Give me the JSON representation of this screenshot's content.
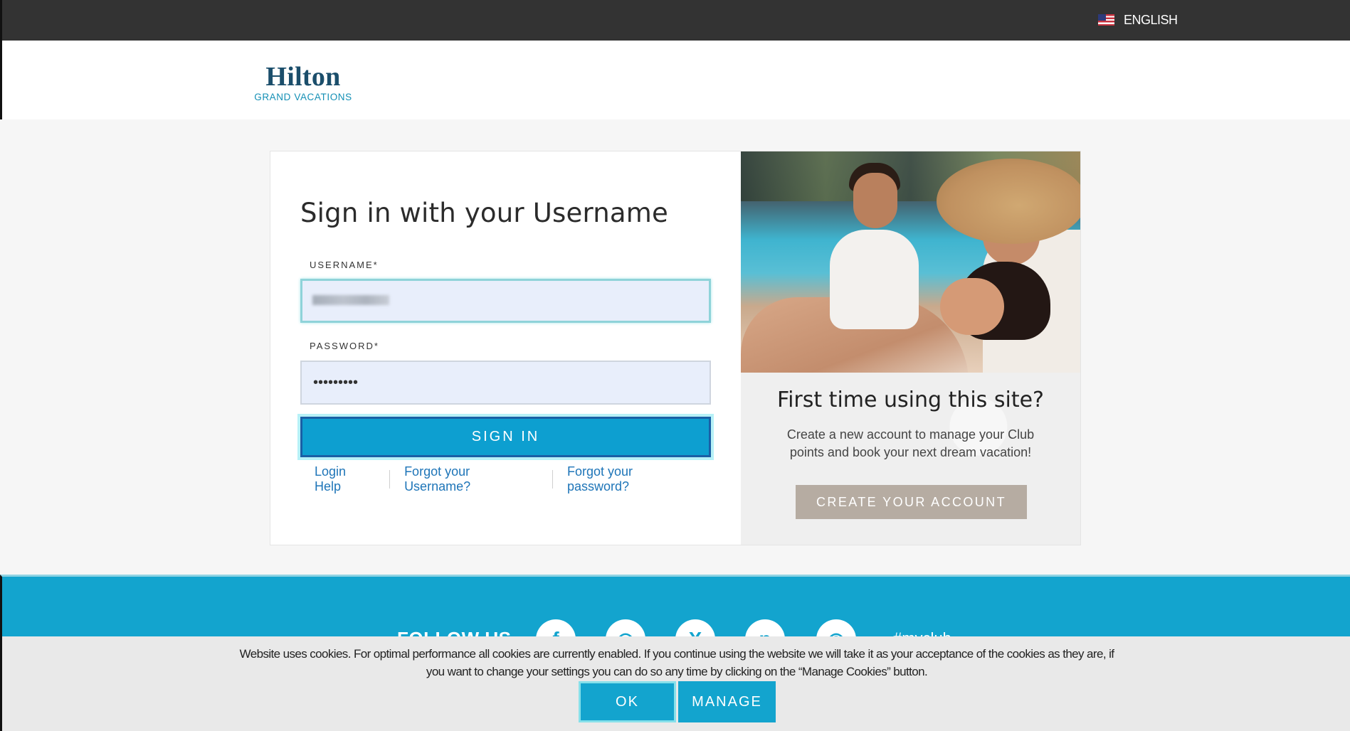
{
  "topbar": {
    "language": "ENGLISH",
    "flag_icon": "us-flag-icon"
  },
  "header": {
    "logo_main": "Hilton",
    "logo_sub": "GRAND VACATIONS"
  },
  "signin": {
    "title": "Sign in with your Username",
    "username_label": "USERNAME*",
    "username_value": "",
    "password_label": "PASSWORD*",
    "password_value": "•••••••••",
    "submit_label": "SIGN IN",
    "help_links": [
      "Login Help",
      "Forgot your Username?",
      "Forgot your password?"
    ]
  },
  "promo": {
    "title": "First time using this site?",
    "description": "Create a new account to manage your Club points and book your next dream vacation!",
    "create_label": "CREATE YOUR ACCOUNT"
  },
  "footer": {
    "follow_label": "FOLLOW US",
    "social_icons": [
      "facebook-icon",
      "instagram-icon",
      "x-icon",
      "pinterest-icon",
      "tripadvisor-icon"
    ],
    "hashtag": "#myclub..."
  },
  "cookie": {
    "text": "Website uses cookies. For optimal performance all cookies are currently enabled. If you continue using the website we will take it as your acceptance of the cookies as they are, if you want to change your settings you can do so any time by clicking on the “Manage Cookies” button.",
    "ok_label": "OK",
    "manage_label": "MANAGE"
  },
  "colors": {
    "primary": "#13a4ce",
    "signin_button": "#0d9fd0",
    "create_button": "#b6aca2",
    "link": "#1e75b8",
    "topbar": "#333333"
  }
}
